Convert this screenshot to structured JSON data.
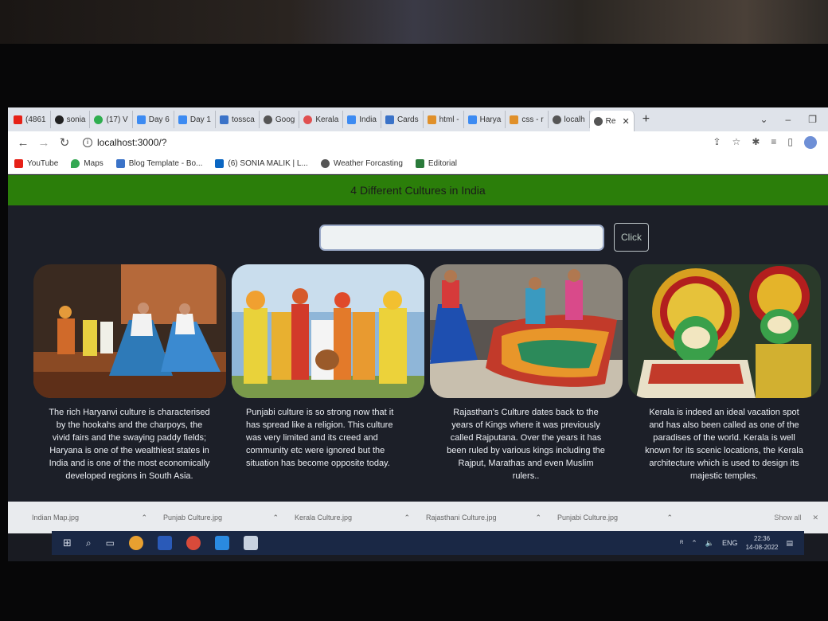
{
  "browser": {
    "tabs": [
      {
        "label": "(4861",
        "color": "#e62117"
      },
      {
        "label": "sonia",
        "color": "#222222"
      },
      {
        "label": "(17) V",
        "color": "#2fae4f"
      },
      {
        "label": "Day 6",
        "color": "#3d8bf2"
      },
      {
        "label": "Day 1",
        "color": "#3d8bf2"
      },
      {
        "label": "tossca",
        "color": "#3b73c8"
      },
      {
        "label": "Goog",
        "color": "#555555"
      },
      {
        "label": "Kerala",
        "color": "#e05050"
      },
      {
        "label": "India",
        "color": "#3d8bf2"
      },
      {
        "label": "Cards",
        "color": "#3b73c8"
      },
      {
        "label": "html -",
        "color": "#e0902a"
      },
      {
        "label": "Harya",
        "color": "#3d8bf2"
      },
      {
        "label": "css - r",
        "color": "#e0902a"
      },
      {
        "label": "localh",
        "color": "#555555"
      },
      {
        "label": "Re",
        "color": "#555555",
        "active": true
      }
    ],
    "new_tab": "+",
    "close_tab": "✕",
    "url": "localhost:3000/?",
    "bookmarks": [
      {
        "label": "YouTube",
        "color": "#e62117"
      },
      {
        "label": "Maps",
        "color": "#34a853"
      },
      {
        "label": "Blog Template - Bo...",
        "color": "#3b73c8"
      },
      {
        "label": "(6) SONIA MALIK | L...",
        "color": "#0a66c2"
      },
      {
        "label": "Weather Forcasting",
        "color": "#555555"
      },
      {
        "label": "Editorial",
        "color": "#2a7a3a"
      }
    ]
  },
  "page": {
    "title": "4 Different Cultures in India",
    "search_value": "",
    "click_label": "Click",
    "cards": [
      {
        "text": "The rich Haryanvi culture is characterised by the hookahs and the charpoys, the vivid fairs and the swaying paddy fields; Haryana is one of the wealthiest states in India and is one of the most economically developed regions in South Asia."
      },
      {
        "text": "Punjabi culture is so strong now that it has spread like a religion. This culture was very limited and its creed and community etc were ignored but the situation has become opposite today."
      },
      {
        "text": "Rajasthan's Culture dates back to the years of Kings where it was previously called Rajputana. Over the years it has been ruled by various kings including the Rajput, Marathas and even Muslim rulers.."
      },
      {
        "text": "Kerala is indeed an ideal vacation spot and has also been called as one of the paradises of the world. Kerala is well known for its scenic locations, the Kerala architecture which is used to design its majestic temples."
      }
    ]
  },
  "downloads": {
    "items": [
      "Indian Map.jpg",
      "Punjab Culture.jpg",
      "Kerala Culture.jpg",
      "Rajasthani Culture.jpg",
      "Punjabi Culture.jpg"
    ],
    "show_all": "Show all"
  },
  "taskbar": {
    "lang": "ENG",
    "time": "22:36",
    "date": "14-08-2022"
  }
}
